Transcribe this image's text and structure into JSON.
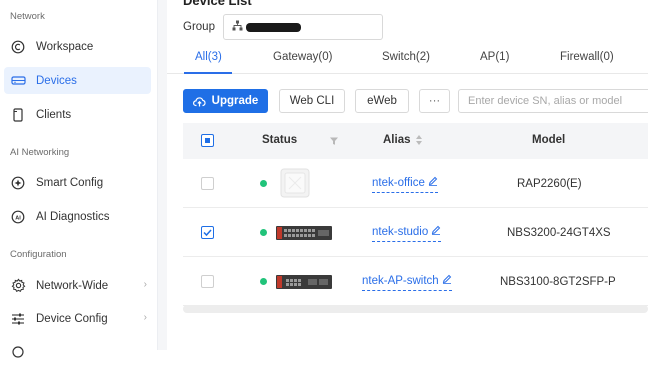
{
  "sidebar": {
    "sections": [
      {
        "title": "Network"
      },
      {
        "title": "AI Networking"
      },
      {
        "title": "Configuration"
      }
    ],
    "items": [
      {
        "label": "Workspace",
        "icon": "workspace-icon",
        "active": false
      },
      {
        "label": "Devices",
        "icon": "devices-icon",
        "active": true
      },
      {
        "label": "Clients",
        "icon": "clients-icon",
        "active": false
      },
      {
        "label": "Smart Config",
        "icon": "smart-config-icon",
        "active": false
      },
      {
        "label": "AI Diagnostics",
        "icon": "ai-diagnostics-icon",
        "active": false
      },
      {
        "label": "Network-Wide",
        "icon": "gear-icon",
        "active": false,
        "chevron": "›"
      },
      {
        "label": "Device Config",
        "icon": "sliders-icon",
        "active": false,
        "chevron": "›"
      }
    ]
  },
  "main": {
    "page_title": "Device List",
    "group": {
      "label": "Group"
    },
    "tabs": [
      {
        "label": "All(3)",
        "active": true
      },
      {
        "label": "Gateway(0)",
        "active": false
      },
      {
        "label": "Switch(2)",
        "active": false
      },
      {
        "label": "AP(1)",
        "active": false
      },
      {
        "label": "Firewall(0)",
        "active": false
      }
    ],
    "toolbar": {
      "upgrade_label": "Upgrade",
      "webcli_label": "Web CLI",
      "eweb_label": "eWeb",
      "more_label": "···",
      "search_placeholder": "Enter device SN, alias or model"
    },
    "table": {
      "headers": {
        "status": "Status",
        "alias": "Alias",
        "model": "Model"
      },
      "rows": [
        {
          "alias": "ntek-office",
          "model": "RAP2260(E)",
          "online": true,
          "checked": false,
          "device": "ap"
        },
        {
          "alias": "ntek-studio",
          "model": "NBS3200-24GT4XS",
          "online": true,
          "checked": true,
          "device": "switch"
        },
        {
          "alias": "ntek-AP-switch",
          "model": "NBS3100-8GT2SFP-P",
          "online": true,
          "checked": false,
          "device": "switch"
        }
      ]
    },
    "colors": {
      "accent": "#1f6fe6",
      "online": "#21c37a",
      "active_bg": "#eaf2fe"
    }
  }
}
